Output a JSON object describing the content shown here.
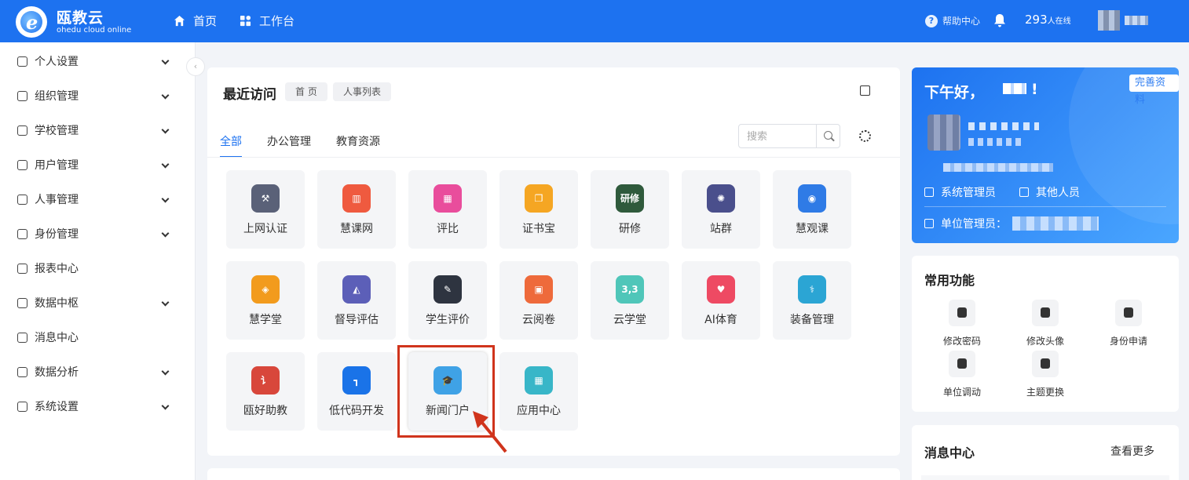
{
  "header": {
    "brand_name": "瓯教云",
    "brand_sub": "ohedu cloud online",
    "nav": [
      {
        "label": "首页",
        "icon": "home-icon"
      },
      {
        "label": "工作台",
        "icon": "grid-icon"
      }
    ],
    "help": "帮助中心",
    "online_count": "293",
    "online_unit": "人在线"
  },
  "sidebar": {
    "items": [
      {
        "label": "个人设置",
        "icon": "user-icon",
        "expandable": true
      },
      {
        "label": "组织管理",
        "icon": "org-icon",
        "expandable": true
      },
      {
        "label": "学校管理",
        "icon": "book-icon",
        "expandable": true
      },
      {
        "label": "用户管理",
        "icon": "users-icon",
        "expandable": true
      },
      {
        "label": "人事管理",
        "icon": "id-card-icon",
        "expandable": true
      },
      {
        "label": "身份管理",
        "icon": "shirt-icon",
        "expandable": true
      },
      {
        "label": "报表中心",
        "icon": "pie-chart-icon",
        "expandable": false
      },
      {
        "label": "数据中枢",
        "icon": "table-icon",
        "expandable": true
      },
      {
        "label": "消息中心",
        "icon": "megaphone-icon",
        "expandable": false
      },
      {
        "label": "数据分析",
        "icon": "line-chart-icon",
        "expandable": true
      },
      {
        "label": "系统设置",
        "icon": "gear-icon",
        "expandable": true
      }
    ]
  },
  "recent": {
    "title": "最近访问",
    "chips": [
      "首 页",
      "人事列表"
    ]
  },
  "tabs": [
    "全部",
    "办公管理",
    "教育资源"
  ],
  "search": {
    "placeholder": "搜索",
    "value": ""
  },
  "apps": [
    {
      "label": "上网认证",
      "color": "#5a6178",
      "glyph": "⚒"
    },
    {
      "label": "慧课网",
      "color": "#ef5a3f",
      "glyph": "▥"
    },
    {
      "label": "评比",
      "color": "#e94d9c",
      "glyph": "▦"
    },
    {
      "label": "证书宝",
      "color": "#f5a623",
      "glyph": "❐"
    },
    {
      "label": "研修",
      "color": "#2f5a3c",
      "glyph": "研修"
    },
    {
      "label": "站群",
      "color": "#4a4f8c",
      "glyph": "✺"
    },
    {
      "label": "慧观课",
      "color": "#2f7be6",
      "glyph": "◉"
    },
    {
      "label": "慧学堂",
      "color": "#f29b1d",
      "glyph": "◈"
    },
    {
      "label": "督导评估",
      "color": "#5c5fb8",
      "glyph": "◭"
    },
    {
      "label": "学生评价",
      "color": "#2e3440",
      "glyph": "✎"
    },
    {
      "label": "云阅卷",
      "color": "#ee6a3b",
      "glyph": "▣"
    },
    {
      "label": "云学堂",
      "color": "#4fc6b9",
      "glyph": "3,3"
    },
    {
      "label": "AI体育",
      "color": "#ee4a63",
      "glyph": "♥"
    },
    {
      "label": "装备管理",
      "color": "#2ba5d4",
      "glyph": "⚕"
    },
    {
      "label": "瓯好助教",
      "color": "#d8473b",
      "glyph": "讠"
    },
    {
      "label": "低代码开发",
      "color": "#1a73e8",
      "glyph": "┓"
    },
    {
      "label": "新闻门户",
      "color": "#3fa2e6",
      "glyph": "🎓"
    },
    {
      "label": "应用中心",
      "color": "#38b6c8",
      "glyph": "▦"
    }
  ],
  "welcome": {
    "greeting": "下午好，",
    "greeting_end": "!",
    "complete_button": "完善资料",
    "roles": [
      "系统管理员",
      "其他人员"
    ],
    "unit_admin_label": "单位管理员："
  },
  "common_functions": {
    "title": "常用功能",
    "items": [
      {
        "label": "修改密码",
        "icon": "shield-icon"
      },
      {
        "label": "修改头像",
        "icon": "smile-icon"
      },
      {
        "label": "身份申请",
        "icon": "info-icon"
      },
      {
        "label": "单位调动",
        "icon": "transfer-icon"
      },
      {
        "label": "主题更换",
        "icon": "brush-icon"
      }
    ]
  },
  "messages": {
    "title": "消息中心",
    "more": "查看更多"
  },
  "colors": {
    "primary": "#1d72f0",
    "highlight_box": "#d0341c"
  }
}
